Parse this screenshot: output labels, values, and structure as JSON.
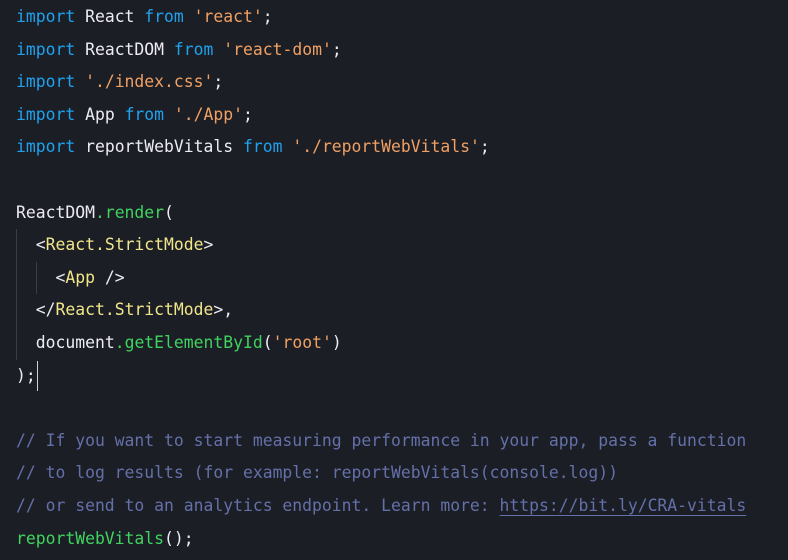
{
  "editor": {
    "language": "javascript",
    "colors": {
      "background": "#1c1e26",
      "keyword": "#1ea2ee",
      "string": "#f0a062",
      "identifier": "#ececf2",
      "jsx_tag": "#f0e68a",
      "function": "#3fd35f",
      "comment": "#6470a8"
    },
    "lines": [
      {
        "indent": 0,
        "tokens": [
          [
            "kw",
            "import"
          ],
          [
            "id",
            " React "
          ],
          [
            "kw",
            "from"
          ],
          [
            "str",
            " 'react'"
          ],
          [
            "punc",
            ";"
          ]
        ]
      },
      {
        "indent": 0,
        "tokens": [
          [
            "kw",
            "import"
          ],
          [
            "id",
            " ReactDOM "
          ],
          [
            "kw",
            "from"
          ],
          [
            "str",
            " 'react-dom'"
          ],
          [
            "punc",
            ";"
          ]
        ]
      },
      {
        "indent": 0,
        "tokens": [
          [
            "kw",
            "import"
          ],
          [
            "str",
            " './index.css'"
          ],
          [
            "punc",
            ";"
          ]
        ]
      },
      {
        "indent": 0,
        "tokens": [
          [
            "kw",
            "import"
          ],
          [
            "id",
            " App "
          ],
          [
            "kw",
            "from"
          ],
          [
            "str",
            " './App'"
          ],
          [
            "punc",
            ";"
          ]
        ]
      },
      {
        "indent": 0,
        "tokens": [
          [
            "kw",
            "import"
          ],
          [
            "id",
            " reportWebVitals "
          ],
          [
            "kw",
            "from"
          ],
          [
            "str",
            " './reportWebVitals'"
          ],
          [
            "punc",
            ";"
          ]
        ]
      },
      {
        "indent": 0,
        "tokens": []
      },
      {
        "indent": 0,
        "tokens": [
          [
            "id",
            "ReactDOM"
          ],
          [
            "fn",
            ".render"
          ],
          [
            "punc",
            "("
          ]
        ]
      },
      {
        "indent": 1,
        "tokens": [
          [
            "punc",
            "<"
          ],
          [
            "tag",
            "React.StrictMode"
          ],
          [
            "punc",
            ">"
          ]
        ]
      },
      {
        "indent": 2,
        "tokens": [
          [
            "punc",
            "<"
          ],
          [
            "tag",
            "App"
          ],
          [
            "punc",
            " />"
          ]
        ]
      },
      {
        "indent": 1,
        "tokens": [
          [
            "punc",
            "</"
          ],
          [
            "tag",
            "React.StrictMode"
          ],
          [
            "punc",
            ">,"
          ]
        ]
      },
      {
        "indent": 1,
        "tokens": [
          [
            "id",
            "document"
          ],
          [
            "fn",
            ".getElementById"
          ],
          [
            "punc",
            "("
          ],
          [
            "str",
            "'root'"
          ],
          [
            "punc",
            ")"
          ]
        ]
      },
      {
        "indent": 0,
        "cursor": true,
        "tokens": [
          [
            "punc",
            ");"
          ]
        ]
      },
      {
        "indent": 0,
        "tokens": []
      },
      {
        "indent": 0,
        "tokens": [
          [
            "cm",
            "// If you want to start measuring performance in your app, pass a function"
          ]
        ]
      },
      {
        "indent": 0,
        "tokens": [
          [
            "cm",
            "// to log results (for example: reportWebVitals(console.log))"
          ]
        ]
      },
      {
        "indent": 0,
        "tokens": [
          [
            "cm",
            "// or send to an analytics endpoint. Learn more: "
          ],
          [
            "link",
            "https://bit.ly/CRA-vitals"
          ]
        ]
      },
      {
        "indent": 0,
        "tokens": [
          [
            "fn",
            "reportWebVitals"
          ],
          [
            "punc",
            "();"
          ]
        ]
      }
    ]
  }
}
